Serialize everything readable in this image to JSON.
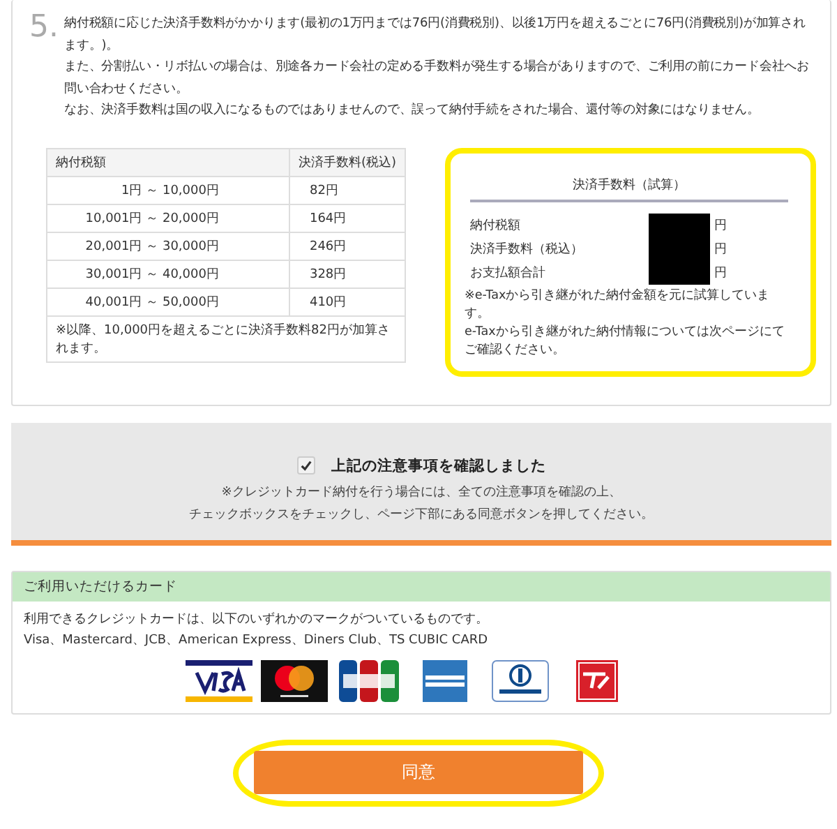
{
  "notice": {
    "step": "5.",
    "paragraphs": [
      "納付税額に応じた決済手数料がかかります(最初の1万円までは76円(消費税別)、以後1万円を超えるごとに76円(消費税別)が加算されます。)。",
      "また、分割払い・リボ払いの場合は、別途各カード会社の定める手数料が発生する場合がありますので、ご利用の前にカード会社へお問い合わせください。",
      "なお、決済手数料は国の収入になるものではありませんので、誤って納付手続をされた場合、還付等の対象にはなりません。"
    ]
  },
  "fee_table": {
    "columns": [
      "納付税額",
      "決済手数料(税込)"
    ],
    "rows": [
      [
        "1円 ～  10,000円",
        "82円"
      ],
      [
        "10,001円 ～  20,000円",
        "164円"
      ],
      [
        "20,001円 ～  30,000円",
        "246円"
      ],
      [
        "30,001円 ～  40,000円",
        "328円"
      ],
      [
        "40,001円 ～  50,000円",
        "410円"
      ]
    ],
    "footnote": "※以降、10,000円を超えるごとに決済手数料82円が加算されます。"
  },
  "estimate": {
    "title": "決済手数料（試算）",
    "highlighted": true,
    "rows": [
      {
        "label": "納付税額",
        "unit": "円",
        "redacted": true
      },
      {
        "label": "決済手数料（税込）",
        "unit": "円",
        "redacted": true
      },
      {
        "label": "お支払額合計",
        "unit": "円",
        "redacted": true
      }
    ],
    "notes": [
      "※e-Taxから引き継がれた納付金額を元に試算しています。",
      "e-Taxから引き継がれた納付情報については次ページにてご確認ください。"
    ]
  },
  "confirm": {
    "checked": true,
    "label": "上記の注意事項を確認しました",
    "notes": [
      "※クレジットカード納付を行う場合には、全ての注意事項を確認の上、",
      "チェックボックスをチェックし、ページ下部にある同意ボタンを押してください。"
    ]
  },
  "cards": {
    "title": "ご利用いただけるカード",
    "text": "利用できるクレジットカードは、以下のいずれかのマークがついているものです。",
    "list": "Visa、Mastercard、JCB、American Express、Diners Club、TS CUBIC CARD",
    "logos": [
      {
        "kind": "visa"
      },
      {
        "kind": "mastercard"
      },
      {
        "kind": "jcb"
      },
      {
        "kind": "amex"
      },
      {
        "kind": "diners"
      },
      {
        "kind": "ts3"
      }
    ]
  },
  "agree_button": {
    "label": "同意",
    "highlighted": true
  }
}
